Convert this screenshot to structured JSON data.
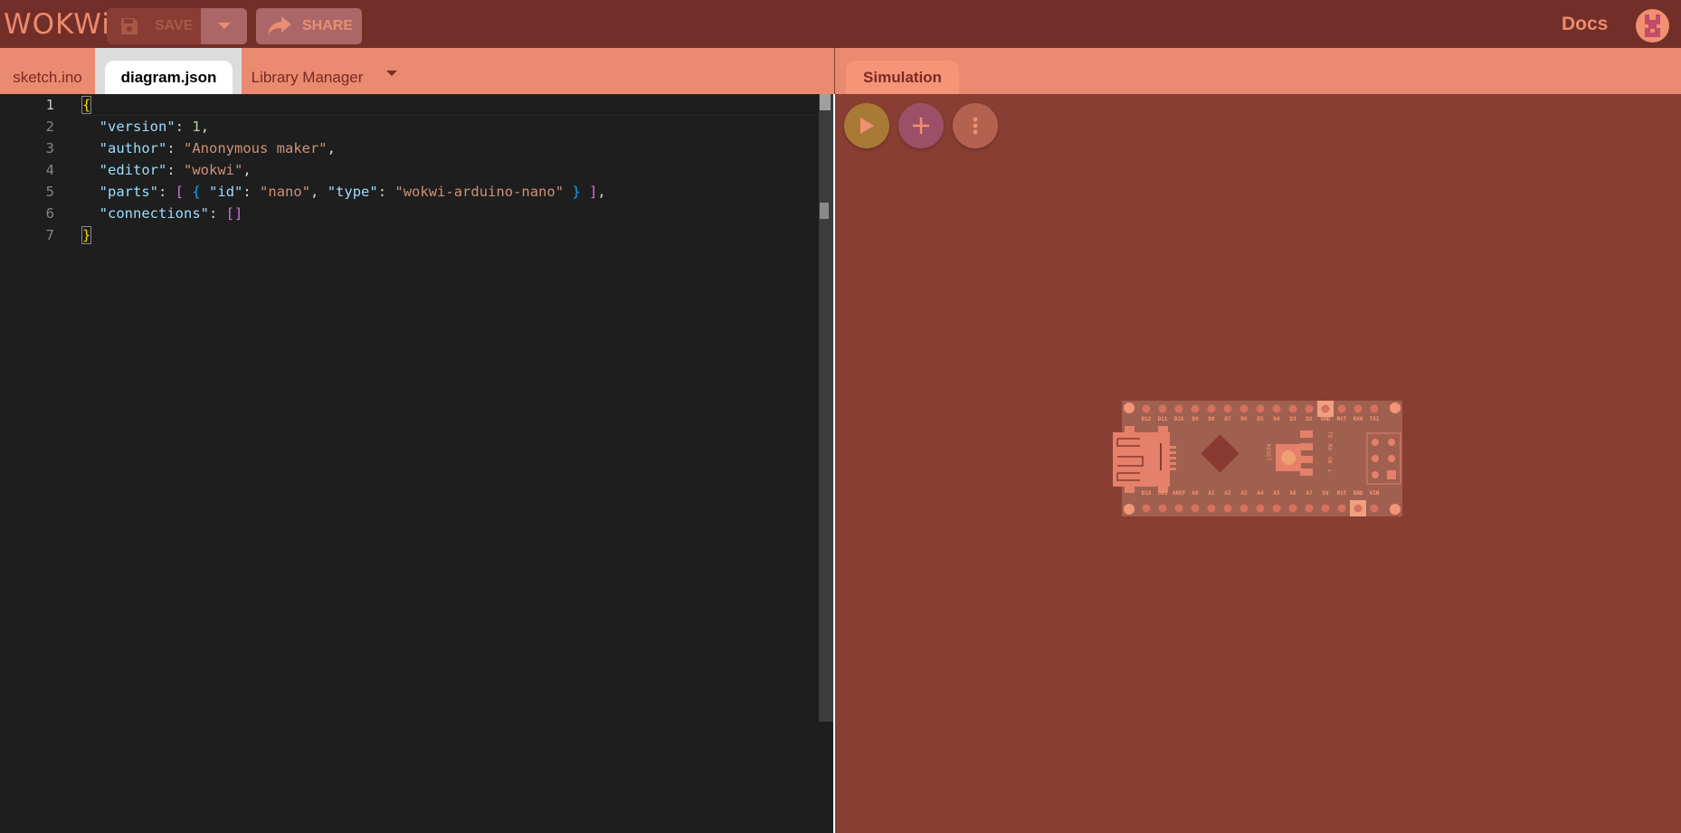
{
  "header": {
    "logo": "WOKWi",
    "save_label": "SAVE",
    "share_label": "SHARE",
    "docs_label": "Docs"
  },
  "editor_tabs": [
    {
      "label": "sketch.ino"
    },
    {
      "label": "diagram.json",
      "active": true
    },
    {
      "label": "Library Manager"
    }
  ],
  "sim_tab": {
    "label": "Simulation"
  },
  "code_lines": [
    {
      "n": "1"
    },
    {
      "n": "2"
    },
    {
      "n": "3"
    },
    {
      "n": "4"
    },
    {
      "n": "5"
    },
    {
      "n": "6"
    },
    {
      "n": "7"
    }
  ],
  "code_tokens": {
    "version_key": "\"version\"",
    "version_val": "1",
    "author_key": "\"author\"",
    "author_val": "\"Anonymous maker\"",
    "editor_key": "\"editor\"",
    "editor_val": "\"wokwi\"",
    "parts_key": "\"parts\"",
    "id_key": "\"id\"",
    "id_val": "\"nano\"",
    "type_key": "\"type\"",
    "type_val": "\"wokwi-arduino-nano\"",
    "connections_key": "\"connections\""
  },
  "board": {
    "top_pins": [
      "D12",
      "D11",
      "D10",
      "D9",
      "D8",
      "D7",
      "D6",
      "D5",
      "D4",
      "D3",
      "D2",
      "GND",
      "RST",
      "RX0",
      "TX1"
    ],
    "bottom_pins": [
      "D13",
      "3V3",
      "AREF",
      "A0",
      "A1",
      "A2",
      "A3",
      "A4",
      "A5",
      "A6",
      "A7",
      "5V",
      "RST",
      "GND",
      "VIN"
    ],
    "led_labels": [
      "TX",
      "RX",
      "ON",
      "L"
    ],
    "reset_label": "RESET"
  },
  "colors": {
    "header": "#722e28",
    "tabbar": "#ea8a70",
    "sim_bg": "#893e33",
    "play": "#a87a36",
    "add": "#9c5068",
    "more": "#b56150"
  }
}
